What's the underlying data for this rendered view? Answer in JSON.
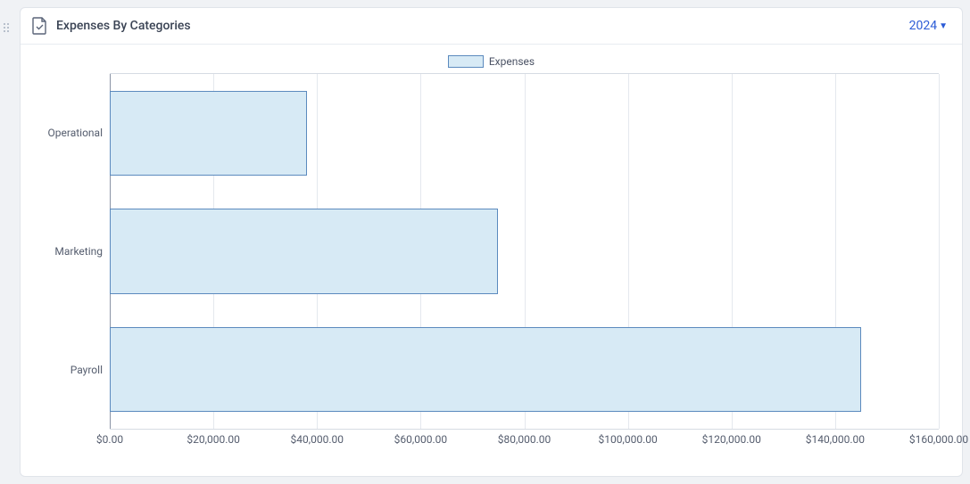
{
  "header": {
    "title": "Expenses By Categories",
    "year": "2024"
  },
  "legend": {
    "series_label": "Expenses"
  },
  "chart_data": {
    "type": "bar",
    "orientation": "horizontal",
    "title": "Expenses By Categories",
    "categories": [
      "Operational",
      "Marketing",
      "Payroll"
    ],
    "series": [
      {
        "name": "Expenses",
        "values": [
          38000,
          75000,
          145000
        ]
      }
    ],
    "xlabel": "",
    "ylabel": "",
    "xlim": [
      0,
      160000
    ],
    "x_ticks": [
      0,
      20000,
      40000,
      60000,
      80000,
      100000,
      120000,
      140000,
      160000
    ],
    "x_tick_labels": [
      "$0.00",
      "$20,000.00",
      "$40,000.00",
      "$60,000.00",
      "$80,000.00",
      "$100,000.00",
      "$120,000.00",
      "$140,000.00",
      "$160,000.00"
    ]
  }
}
